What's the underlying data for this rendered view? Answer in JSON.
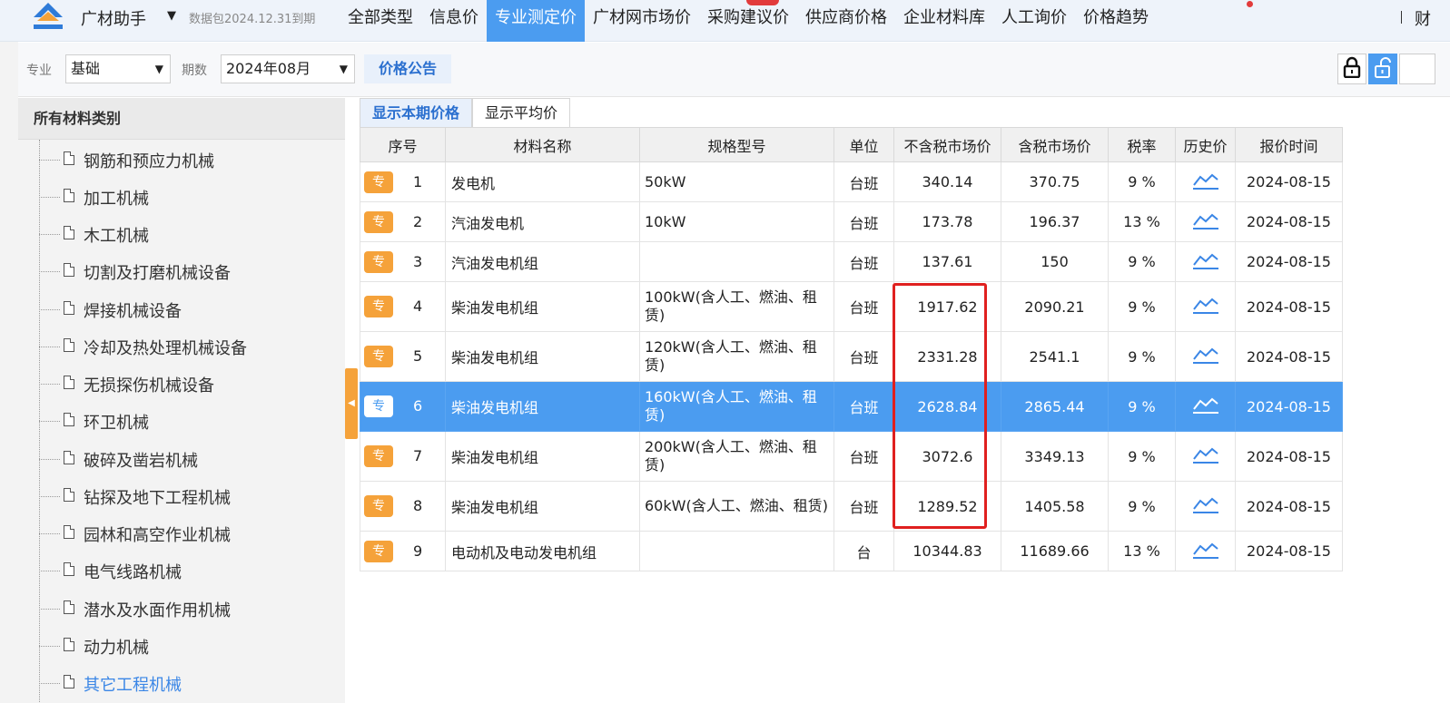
{
  "header": {
    "app_name": "广材助手",
    "app_caret": "▼",
    "package_note": "数据包2024.12.31到期",
    "nav": [
      "全部类型",
      "信息价",
      "专业测定价",
      "广材网市场价",
      "采购建议价",
      "供应商价格",
      "企业材料库",
      "人工询价",
      "价格趋势"
    ],
    "active_nav": "专业测定价",
    "cut_text": "财"
  },
  "filters": {
    "major_label": "专业",
    "major_value": "基础",
    "period_label": "期数",
    "period_value": "2024年08月",
    "notice_button": "价格公告",
    "caret": "▼"
  },
  "sidebar": {
    "title": "所有材料类别",
    "items": [
      "钢筋和预应力机械",
      "加工机械",
      "木工机械",
      "切割及打磨机械设备",
      "焊接机械设备",
      "冷却及热处理机械设备",
      "无损探伤机械设备",
      "环卫机械",
      "破碎及凿岩机械",
      "钻探及地下工程机械",
      "园林和高空作业机械",
      "电气线路机械",
      "潜水及水面作用机械",
      "动力机械",
      "其它工程机械"
    ],
    "active_item": "其它工程机械"
  },
  "tabs": [
    "显示本期价格",
    "显示平均价"
  ],
  "table": {
    "columns": [
      "序号",
      "材料名称",
      "规格型号",
      "单位",
      "不含税市场价",
      "含税市场价",
      "税率",
      "历史价",
      "报价时间"
    ],
    "tag_label": "专",
    "rows": [
      {
        "no": "1",
        "name": "发电机",
        "spec": "50kW",
        "unit": "台班",
        "price_ex": "340.14",
        "price_in": "370.75",
        "tax": "9 %",
        "date": "2024-08-15"
      },
      {
        "no": "2",
        "name": "汽油发电机",
        "spec": "10kW",
        "unit": "台班",
        "price_ex": "173.78",
        "price_in": "196.37",
        "tax": "13 %",
        "date": "2024-08-15"
      },
      {
        "no": "3",
        "name": "汽油发电机组",
        "spec": "",
        "unit": "台班",
        "price_ex": "137.61",
        "price_in": "150",
        "tax": "9 %",
        "date": "2024-08-15"
      },
      {
        "no": "4",
        "name": "柴油发电机组",
        "spec": "100kW(含人工、燃油、租赁)",
        "unit": "台班",
        "price_ex": "1917.62",
        "price_in": "2090.21",
        "tax": "9 %",
        "date": "2024-08-15"
      },
      {
        "no": "5",
        "name": "柴油发电机组",
        "spec": "120kW(含人工、燃油、租赁)",
        "unit": "台班",
        "price_ex": "2331.28",
        "price_in": "2541.1",
        "tax": "9 %",
        "date": "2024-08-15"
      },
      {
        "no": "6",
        "name": "柴油发电机组",
        "spec": "160kW(含人工、燃油、租赁)",
        "unit": "台班",
        "price_ex": "2628.84",
        "price_in": "2865.44",
        "tax": "9 %",
        "date": "2024-08-15"
      },
      {
        "no": "7",
        "name": "柴油发电机组",
        "spec": "200kW(含人工、燃油、租赁)",
        "unit": "台班",
        "price_ex": "3072.6",
        "price_in": "3349.13",
        "tax": "9 %",
        "date": "2024-08-15"
      },
      {
        "no": "8",
        "name": "柴油发电机组",
        "spec": "60kW(含人工、燃油、租赁)",
        "unit": "台班",
        "price_ex": "1289.52",
        "price_in": "1405.58",
        "tax": "9 %",
        "date": "2024-08-15"
      },
      {
        "no": "9",
        "name": "电动机及电动发电机组",
        "spec": "",
        "unit": "台",
        "price_ex": "10344.83",
        "price_in": "11689.66",
        "tax": "13 %",
        "date": "2024-08-15"
      }
    ],
    "selected_row_no": "6",
    "trend_icon": "trend-chart-icon"
  },
  "colors": {
    "accent": "#4b9cf0",
    "tag": "#f5a23a",
    "highlight_box": "#e0201f"
  }
}
